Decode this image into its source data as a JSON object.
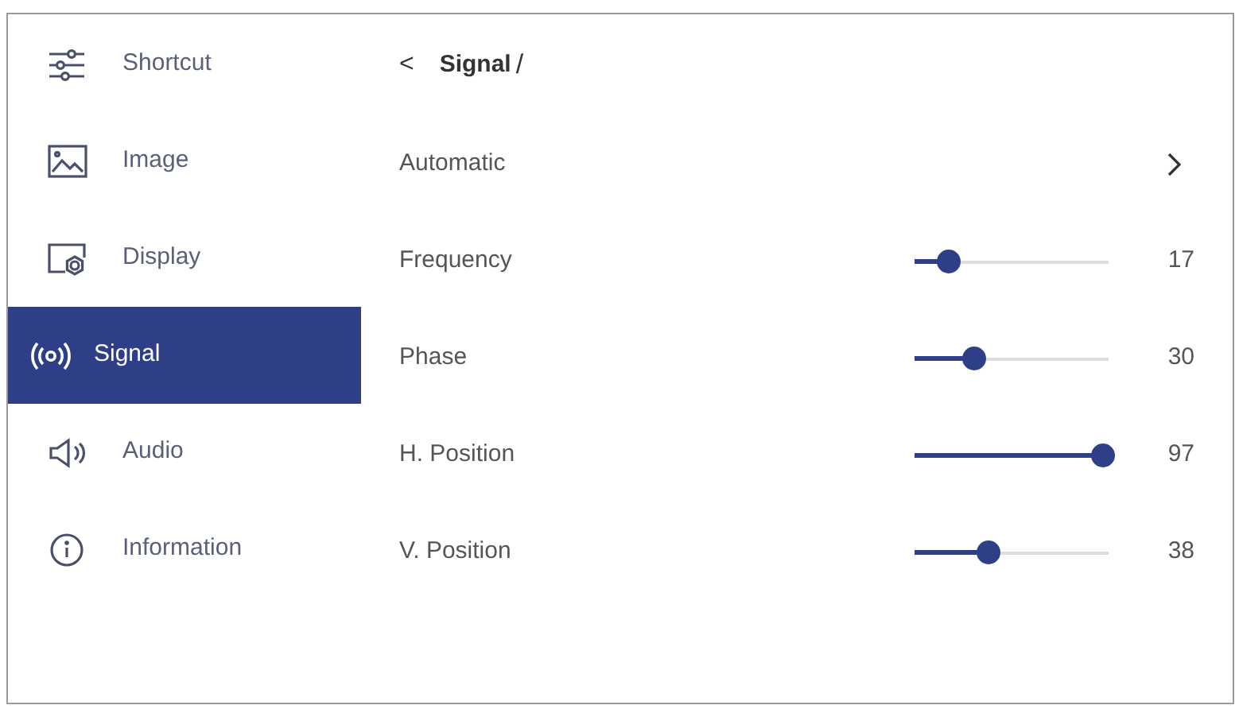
{
  "sidebar": {
    "items": [
      {
        "label": "Shortcut",
        "selected": false
      },
      {
        "label": "Image",
        "selected": false
      },
      {
        "label": "Display",
        "selected": false
      },
      {
        "label": "Signal",
        "selected": true
      },
      {
        "label": "Audio",
        "selected": false
      },
      {
        "label": "Information",
        "selected": false
      }
    ]
  },
  "header": {
    "back": "<",
    "title": "Signal",
    "separator": "/"
  },
  "rows": [
    {
      "kind": "link",
      "label": "Automatic"
    },
    {
      "kind": "slider",
      "label": "Frequency",
      "level": 0.17,
      "reading": "17"
    },
    {
      "kind": "slider",
      "label": "Phase",
      "level": 0.3,
      "reading": "30"
    },
    {
      "kind": "slider",
      "label": "H. Position",
      "level": 0.97,
      "reading": "97"
    },
    {
      "kind": "slider",
      "label": "V. Position",
      "level": 0.38,
      "reading": "38"
    }
  ]
}
